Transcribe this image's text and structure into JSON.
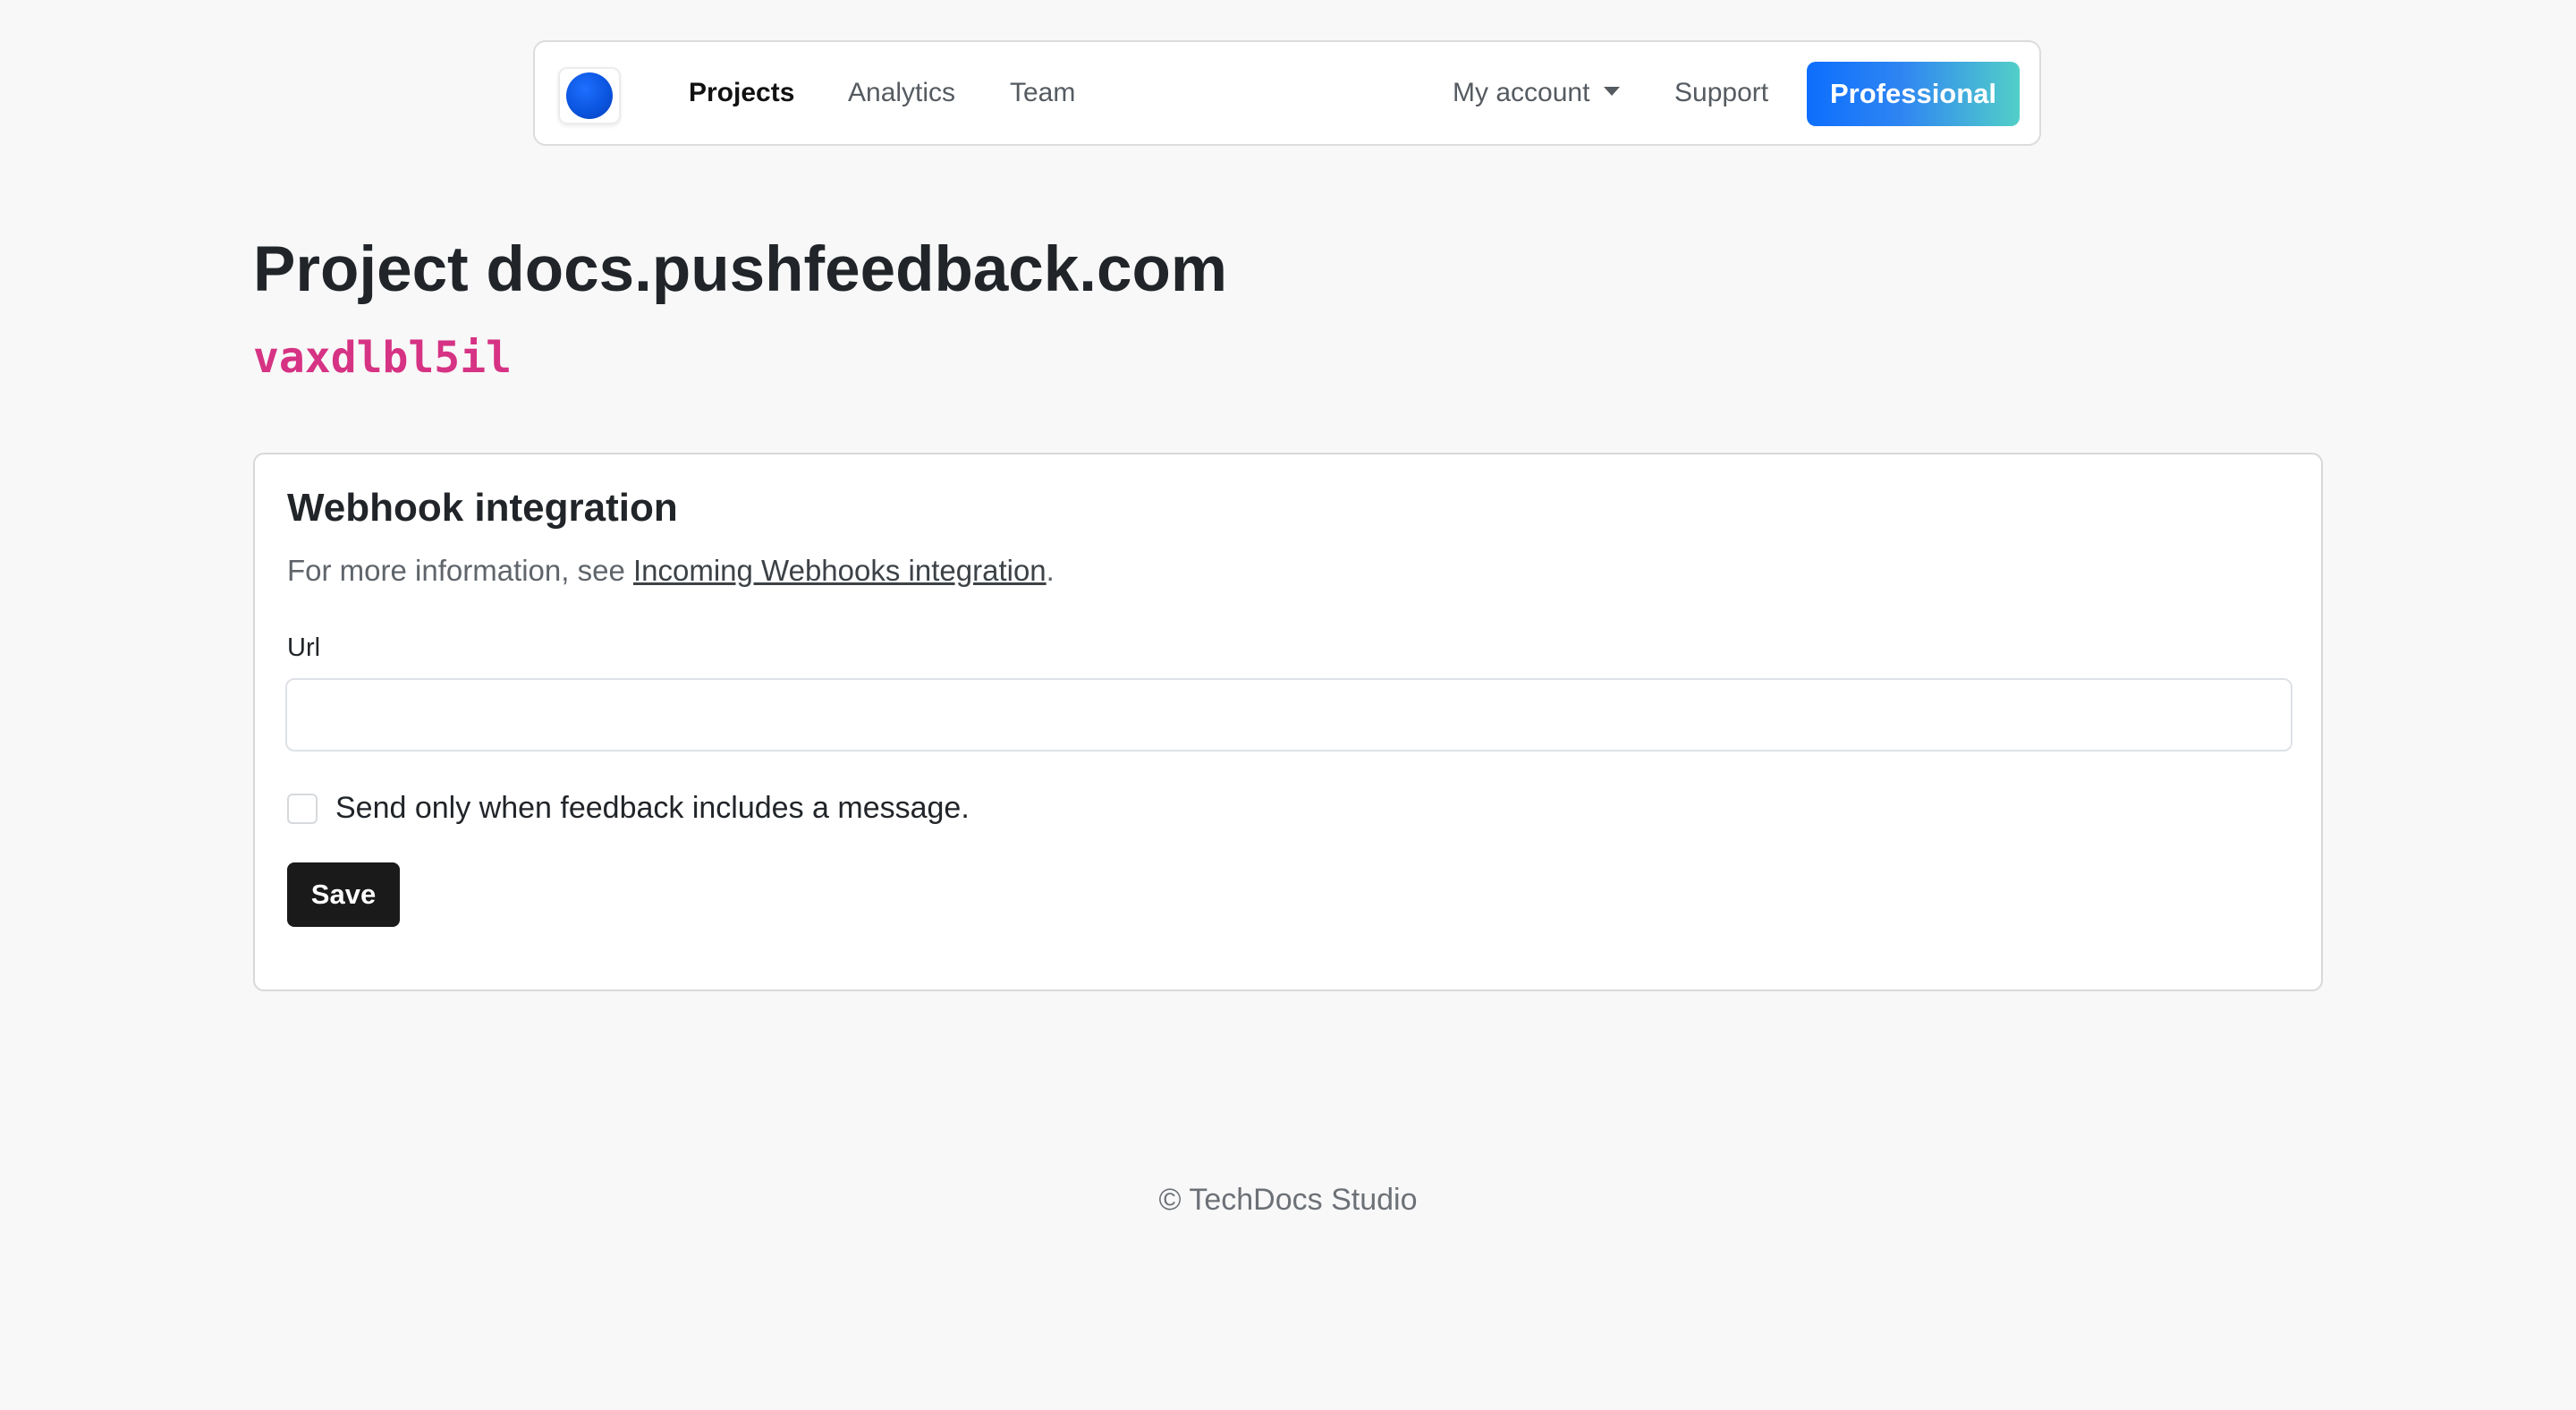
{
  "nav": {
    "logo_icon": "app-logo-circle-icon",
    "links": [
      {
        "label": "Projects",
        "active": true
      },
      {
        "label": "Analytics",
        "active": false
      },
      {
        "label": "Team",
        "active": false
      }
    ],
    "account_label": "My account",
    "support_label": "Support",
    "plan_label": "Professional"
  },
  "header": {
    "title": "Project docs.pushfeedback.com",
    "project_id": "vaxdlbl5il"
  },
  "webhook": {
    "title": "Webhook integration",
    "info_prefix": "For more information, see ",
    "info_link": "Incoming Webhooks integration",
    "info_suffix": ".",
    "url_label": "Url",
    "url_value": "",
    "checkbox_label": "Send only when feedback includes a message.",
    "checkbox_checked": false,
    "save_label": "Save"
  },
  "footer": {
    "text": "© TechDocs Studio"
  },
  "colors": {
    "background": "#f8f8f8",
    "brand_blue": "#0d6efd",
    "gradient_end": "#52cfc8",
    "project_id": "#d63384",
    "save_button": "#1a1a1a"
  }
}
